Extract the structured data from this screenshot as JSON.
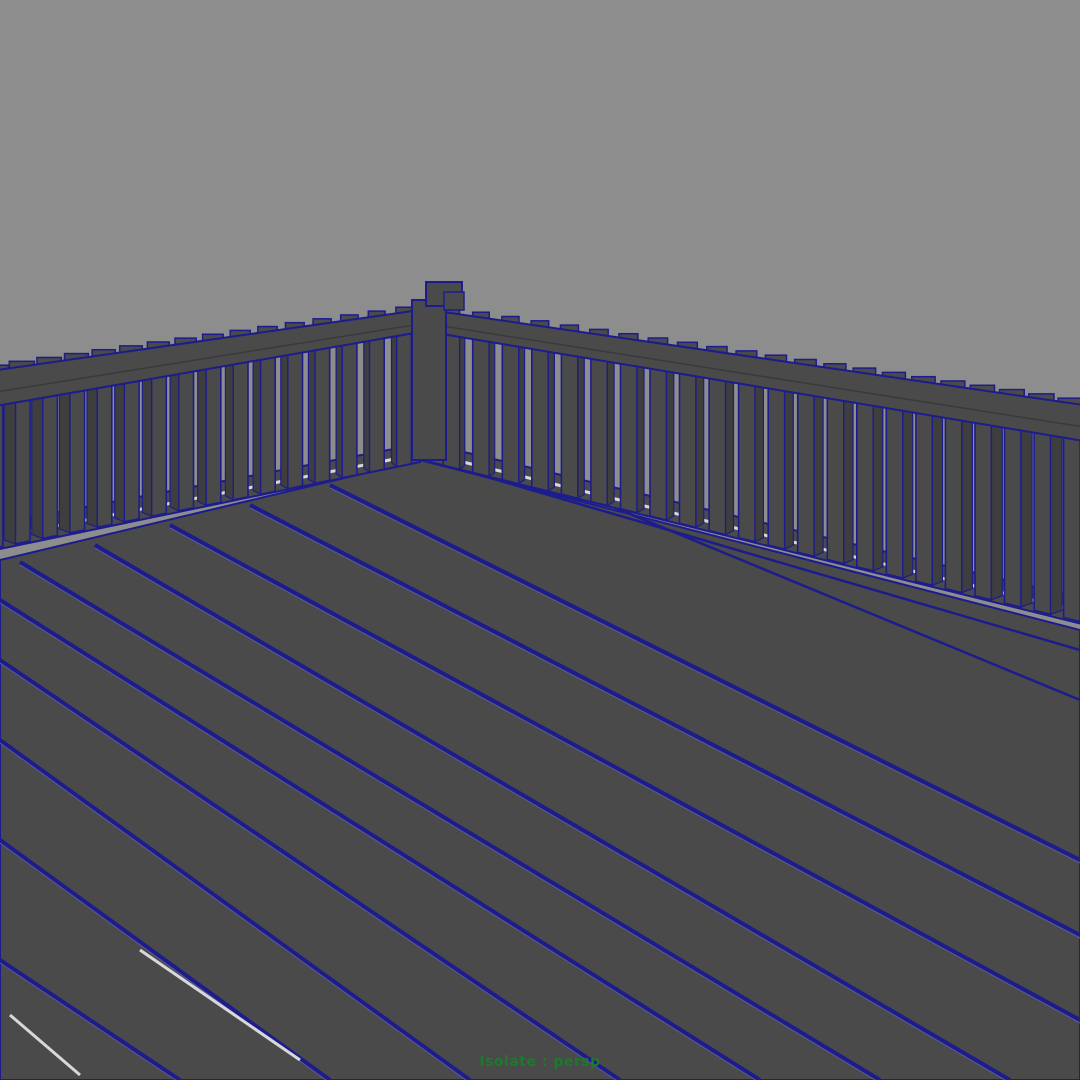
{
  "viewport": {
    "background_color": "#8d8d8d",
    "mesh_fill_color": "#4a4a4a",
    "wireframe_color": "#1c1c8c",
    "highlight_color": "#d8d8d8",
    "camera_label": "Isolate : persp",
    "camera_label_color": "#1b7a2c"
  }
}
